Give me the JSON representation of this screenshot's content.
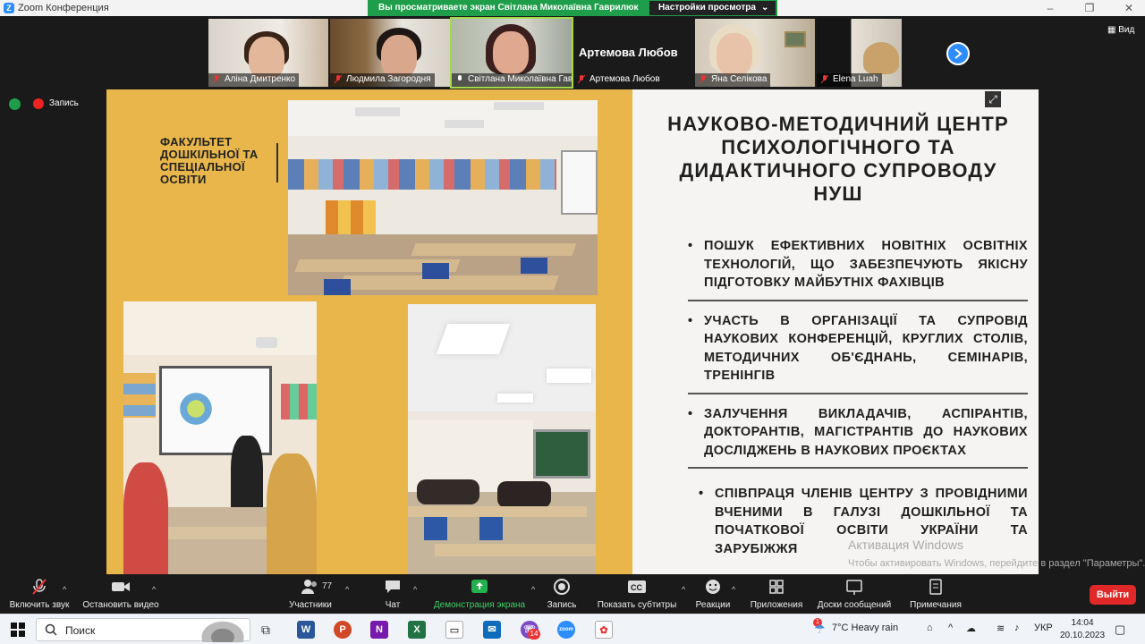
{
  "window": {
    "title": "Zoom Конференция"
  },
  "share_banner": {
    "message": "Вы просматриваете экран Світлана Миколаївна Гаврилюк",
    "options": "Настройки просмотра"
  },
  "participants": [
    {
      "name": "Аліна Дмитренко"
    },
    {
      "name": "Людмила Загородня"
    },
    {
      "name": "Світлана Миколаївна Гав..."
    },
    {
      "name": "Артемова Любов",
      "big_label": "Артемова Любов"
    },
    {
      "name": "Яна Селікова"
    },
    {
      "name": "Elena Luah"
    }
  ],
  "view_button": "Вид",
  "recording_label": "Запись",
  "slide": {
    "faculty": [
      "ФАКУЛЬТЕТ",
      "ДОШКІЛЬНОЇ ТА",
      "СПЕЦІАЛЬНОЇ",
      "ОСВІТИ"
    ],
    "heading": [
      "НАУКОВО-МЕТОДИЧНИЙ ЦЕНТР",
      "ПСИХОЛОГІЧНОГО ТА",
      "ДИДАКТИЧНОГО СУПРОВОДУ",
      "НУШ"
    ],
    "bullets": [
      "ПОШУК ЕФЕКТИВНИХ НОВІТНІХ ОСВІТНІХ ТЕХНОЛОГІЙ, ЩО ЗАБЕЗПЕЧУЮТЬ ЯКІСНУ ПІДГОТОВКУ МАЙБУТНІХ ФАХІВЦІВ",
      "УЧАСТЬ В ОРГАНІЗАЦІЇ ТА СУПРОВІД НАУКОВИХ КОНФЕРЕНЦІЙ, КРУГЛИХ СТОЛІВ, МЕТОДИЧНИХ ОБ'ЄДНАНЬ, СЕМІНАРІВ, ТРЕНІНГІВ",
      "ЗАЛУЧЕННЯ ВИКЛАДАЧІВ, АСПІРАНТІВ, ДОКТОРАНТІВ, МАГІСТРАНТІВ ДО НАУКОВИХ ДОСЛІДЖЕНЬ В НАУКОВИХ ПРОЄКТАХ",
      "СПІВПРАЦЯ ЧЛЕНІВ ЦЕНТРУ З ПРОВІДНИМИ ВЧЕНИМИ В ГАЛУЗІ ДОШКІЛЬНОЇ ТА ПОЧАТКОВОЇ ОСВІТИ УКРАЇНИ ТА ЗАРУБІЖЖЯ"
    ]
  },
  "activation": {
    "title": "Активация Windows",
    "hint": "Чтобы активировать Windows, перейдите в раздел \"Параметры\"."
  },
  "toolbar": {
    "unmute": "Включить звук",
    "stop_video": "Остановить видео",
    "participants": "Участники",
    "participants_count": "77",
    "chat": "Чат",
    "share_screen": "Демонстрация экрана",
    "record": "Запись",
    "captions": "Показать субтитры",
    "reactions": "Реакции",
    "apps": "Приложения",
    "whiteboards": "Доски сообщений",
    "notes": "Примечания",
    "leave": "Выйти"
  },
  "taskbar": {
    "search": "Поиск",
    "weather_badge": "1",
    "weather": "7°C  Heavy rain",
    "language": "УКР",
    "time": "14:04",
    "date": "20.10.2023",
    "viber_badge": "14"
  },
  "colors": {
    "zoom_blue": "#2d8cff",
    "share_green": "#1e9e4a",
    "leave_red": "#e02828",
    "slide_mustard": "#e8b64a"
  }
}
